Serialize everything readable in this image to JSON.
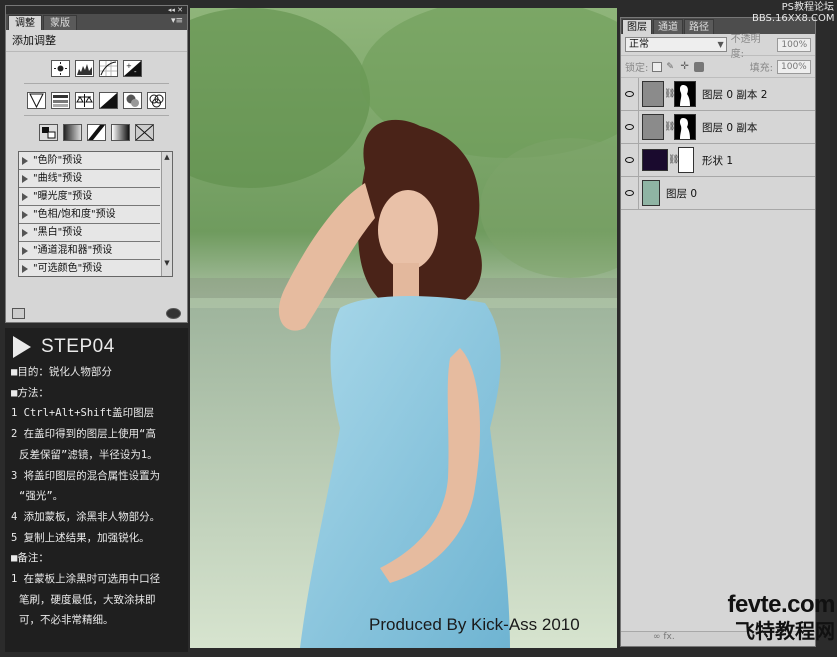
{
  "adjustments_panel": {
    "tabs": [
      "调整",
      "蒙版"
    ],
    "title": "添加调整",
    "presets": [
      "\"色阶\"预设",
      "\"曲线\"预设",
      "\"曝光度\"预设",
      "\"色相/饱和度\"预设",
      "\"黑白\"预设",
      "\"通道混和器\"预设",
      "\"可选颜色\"预设"
    ]
  },
  "steps": {
    "title": "STEP04",
    "lines": [
      "■目的：锐化人物部分",
      "■方法：",
      "1 Ctrl+Alt+Shift盖印图层",
      "2 在盖印得到的图层上使用“高",
      "反差保留”滤镜，半径设为1。",
      "3 将盖印图层的混合属性设置为",
      "“强光”。",
      "4 添加蒙板，涂黑非人物部分。",
      "5 复制上述结果，加强锐化。",
      "■备注：",
      "1 在蒙板上涂黑时可选用中口径",
      "笔刷，硬度最低，大致涂抹即",
      "可，不必非常精细。"
    ]
  },
  "photo": {
    "credit": "Produced By Kick-Ass 2010"
  },
  "layers_panel": {
    "tabs": [
      "图层",
      "通道",
      "路径"
    ],
    "blend_mode": "正常",
    "opacity_label": "不透明度:",
    "opacity_value": "100%",
    "lock_label": "锁定:",
    "fill_label": "填充:",
    "fill_value": "100%",
    "layers": [
      {
        "name": "图层 0 副本 2"
      },
      {
        "name": "图层 0 副本"
      },
      {
        "name": "形状 1"
      },
      {
        "name": "图层 0"
      }
    ],
    "footer": "∞  fx."
  },
  "watermark": {
    "top_line1": "PS教程论坛",
    "top_line2": "BBS.16XX8.COM",
    "bottom_line1": "fevte.com",
    "bottom_line2": "飞特教程网"
  }
}
